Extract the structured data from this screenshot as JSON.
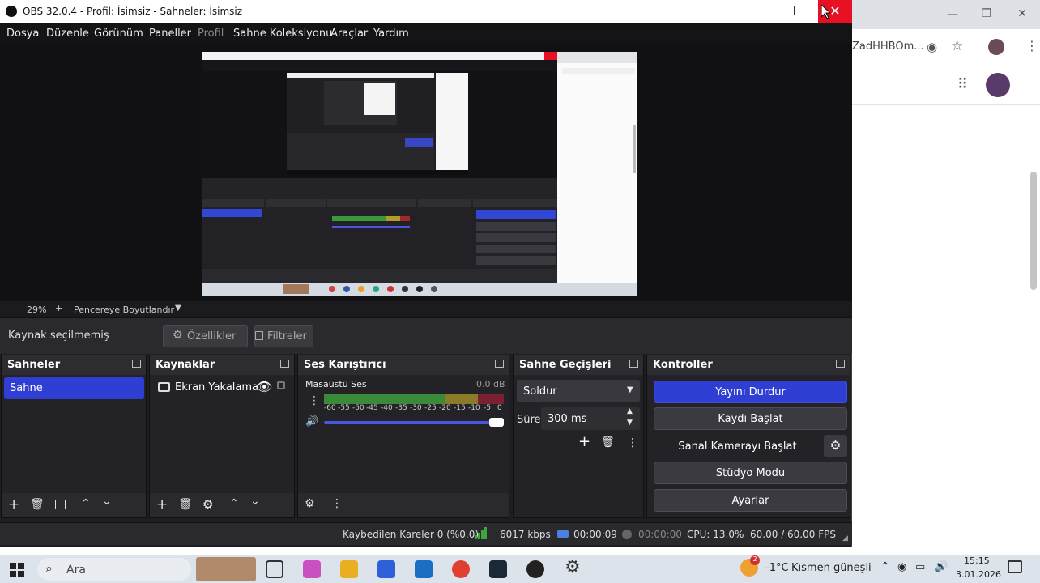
{
  "window": {
    "title": "OBS 32.0.4 - Profil: İsimsiz - Sahneler: İsimsiz"
  },
  "menu": [
    "Dosya",
    "Düzenle",
    "Görünüm",
    "Paneller",
    "Profil",
    "Sahne Koleksiyonu",
    "Araçlar",
    "Yardım"
  ],
  "zoom": {
    "minus": "−",
    "value": "29%",
    "plus": "+",
    "fit_label": "Pencereye Boyutlandır"
  },
  "source_bar": {
    "status": "Kaynak seçilmemiş",
    "properties": "Özellikler",
    "filters": "Filtreler"
  },
  "docks": {
    "scenes": {
      "title": "Sahneler",
      "items": [
        "Sahne"
      ]
    },
    "sources": {
      "title": "Kaynaklar",
      "items": [
        "Ekran Yakalama"
      ]
    },
    "mixer": {
      "title": "Ses Karıştırıcı",
      "track": "Masaüstü Ses",
      "db": "0.0 dB",
      "ticks": [
        "-60",
        "-55",
        "-50",
        "-45",
        "-40",
        "-35",
        "-30",
        "-25",
        "-20",
        "-15",
        "-10",
        "-5",
        "0"
      ]
    },
    "transitions": {
      "title": "Sahne Geçişleri",
      "type": "Soldur",
      "duration_label": "Süre",
      "duration": "300 ms"
    },
    "controls": {
      "title": "Kontroller",
      "stream": "Yayını Durdur",
      "record": "Kaydı Başlat",
      "virtualcam": "Sanal Kamerayı Başlat",
      "studio": "Stüdyo Modu",
      "settings": "Ayarlar"
    }
  },
  "status": {
    "dropped": "Kaybedilen Kareler 0 (%0.0)",
    "bitrate": "6017 kbps",
    "stream_time": "00:00:09",
    "rec_time": "00:00:00",
    "cpu": "CPU: 13.0%",
    "fps": "60.00 / 60.00 FPS"
  },
  "browser": {
    "address_fragment": "ZadHHBOm..."
  },
  "taskbar": {
    "search": "Ara",
    "weather_temp": "-1°C",
    "weather_desc": "Kısmen güneşli",
    "time": "15:15",
    "date": "3.01.2026",
    "notif_count": "2"
  },
  "colors": {
    "accent": "#2f3fd3",
    "window_bg": "#1e1e22",
    "close_red": "#e81123"
  }
}
